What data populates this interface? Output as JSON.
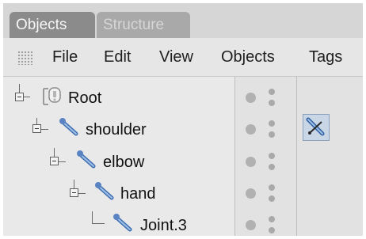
{
  "tabs": [
    {
      "label": "Objects",
      "active": true
    },
    {
      "label": "Structure",
      "active": false
    }
  ],
  "menu": [
    "File",
    "Edit",
    "View",
    "Objects",
    "Tags"
  ],
  "tree": [
    {
      "label": "Root",
      "icon": "null-object-icon"
    },
    {
      "label": "shoulder",
      "icon": "joint-icon"
    },
    {
      "label": "elbow",
      "icon": "joint-icon"
    },
    {
      "label": "hand",
      "icon": "joint-icon"
    },
    {
      "label": "Joint.3",
      "icon": "joint-icon"
    }
  ],
  "tags": [
    {
      "row": "shoulder",
      "icon": "ik-tag-icon"
    }
  ],
  "colors": {
    "active_tab": "#8b8b8b",
    "inactive_tab": "#a9a9a9",
    "joint_icon": "#3f6fb0"
  }
}
